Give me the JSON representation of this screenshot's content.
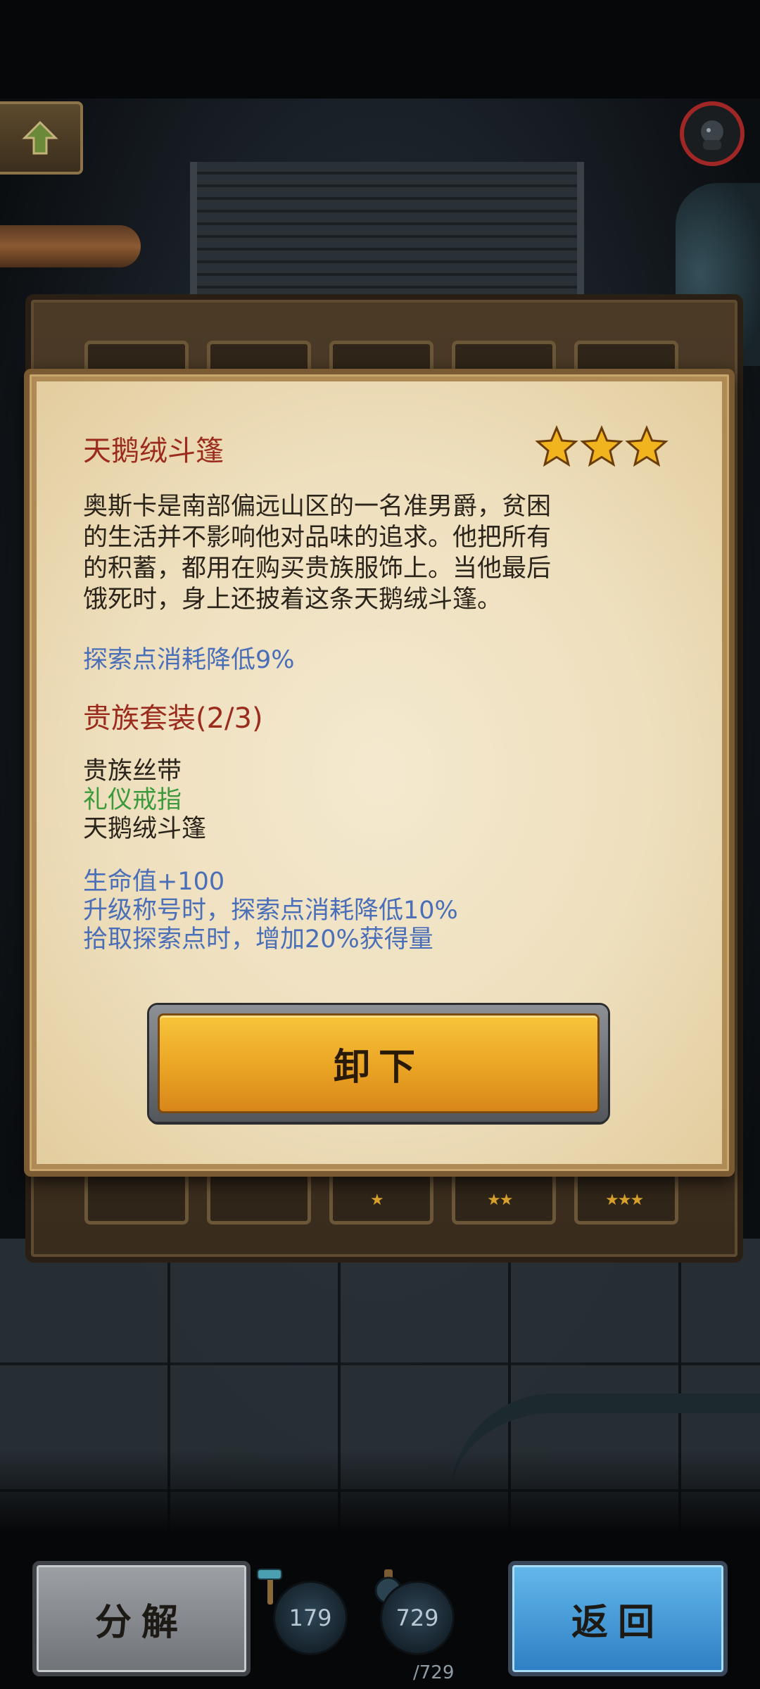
{
  "item": {
    "name": "天鹅绒斗篷",
    "stars": 3,
    "description_lines": [
      "奥斯卡是南部偏远山区的一名准男爵，贫困",
      "的生活并不影响他对品味的追求。他把所有",
      "的积蓄，都用在购买贵族服饰上。当他最后",
      "饿死时，身上还披着这条天鹅绒斗篷。"
    ],
    "effect": "探索点消耗降低9%"
  },
  "set": {
    "title": "贵族套装(2/3)",
    "items": [
      {
        "label": "贵族丝带",
        "owned": false
      },
      {
        "label": "礼仪戒指",
        "owned": true
      },
      {
        "label": "天鹅绒斗篷",
        "owned": false
      }
    ],
    "bonuses": [
      "生命值+100",
      "升级称号时，探索点消耗降低10%",
      "拾取探索点时，增加20%获得量"
    ]
  },
  "buttons": {
    "unequip": "卸下",
    "decompose": "分解",
    "return": "返回"
  },
  "resources": {
    "material": "179",
    "explore_current": "729",
    "explore_max": "/729"
  },
  "slot_stars": [
    "★",
    "★★",
    "★★★"
  ],
  "colors": {
    "title_red": "#9b2b1c",
    "effect_blue": "#4a6fb8",
    "owned_green": "#3b9a3b",
    "star_gold": "#f2b41e"
  }
}
